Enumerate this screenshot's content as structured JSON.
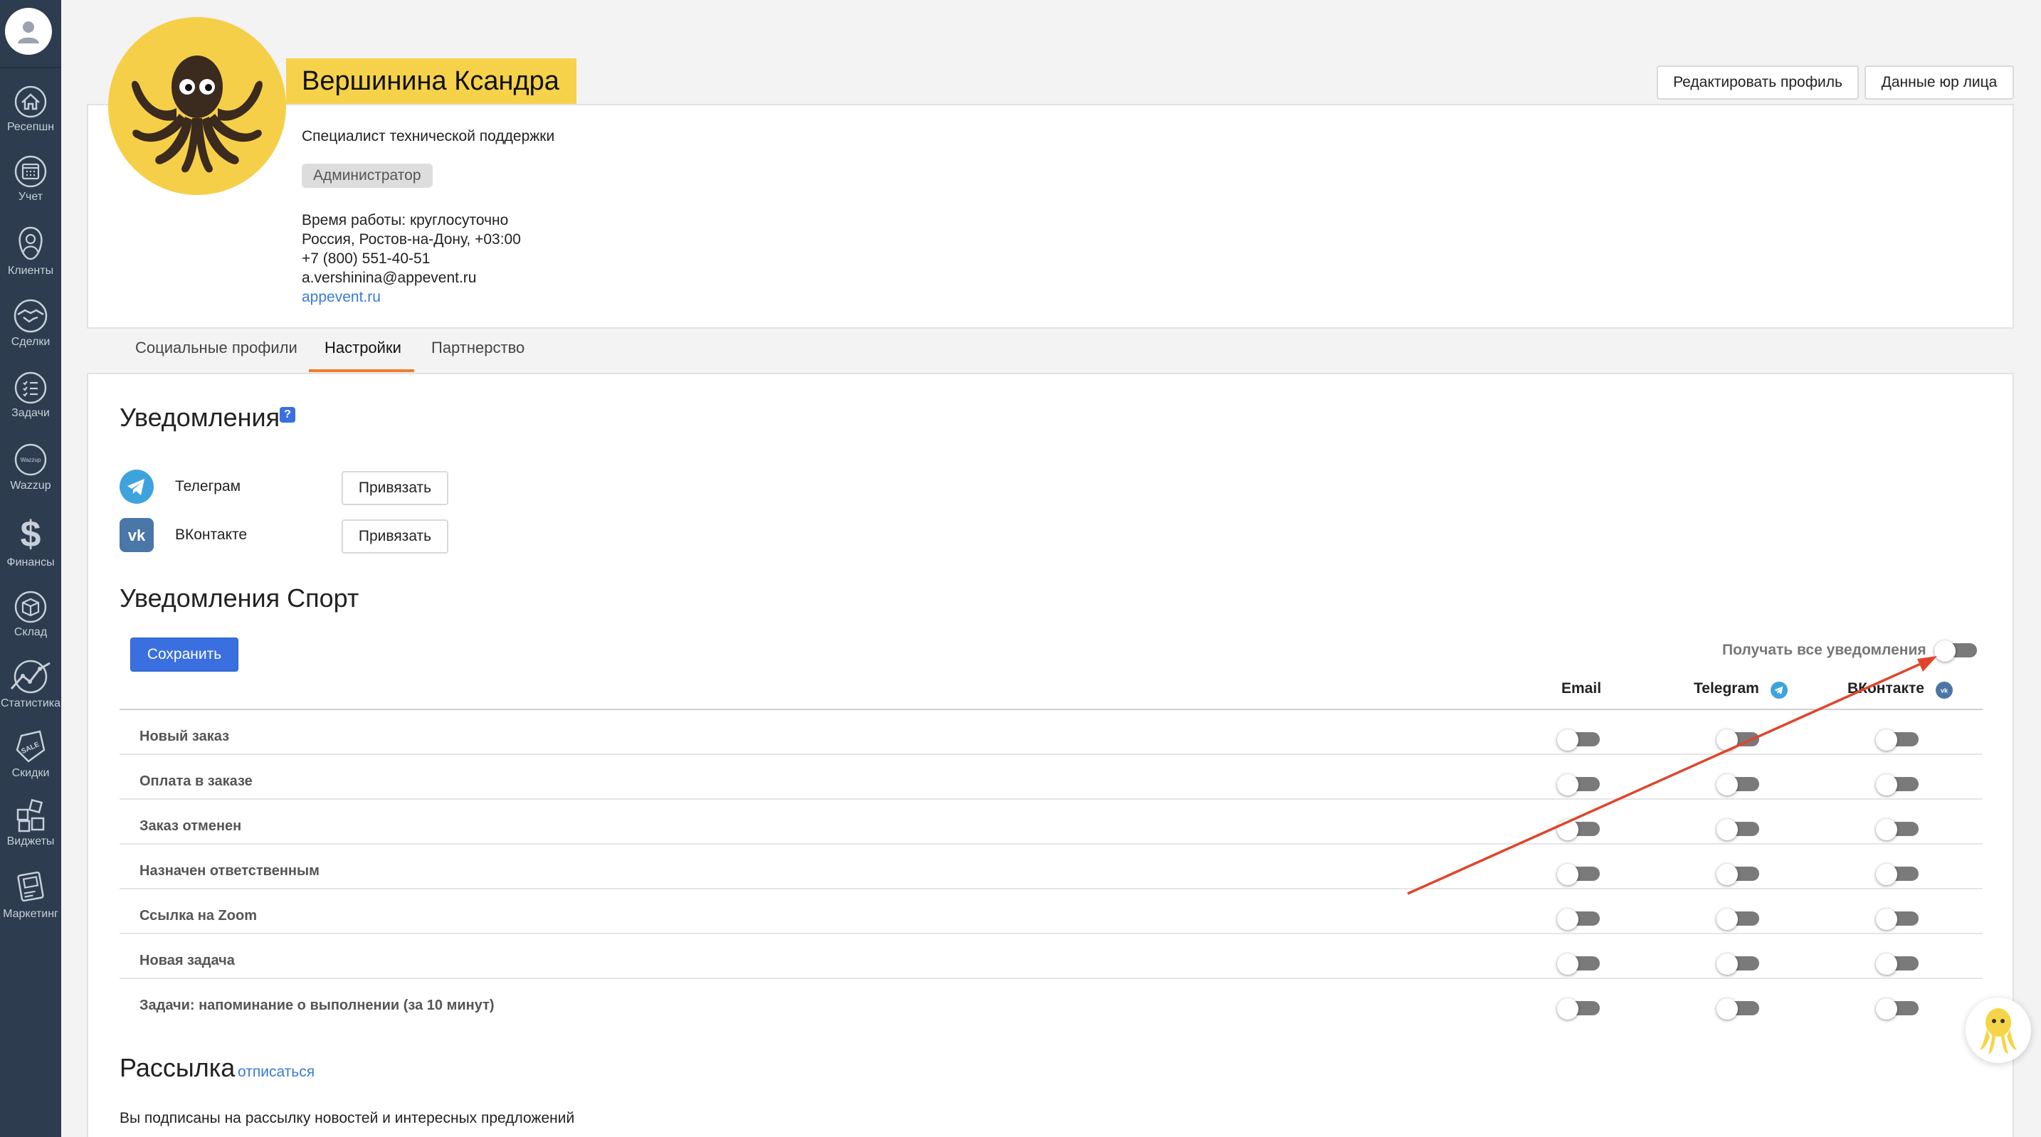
{
  "sidebar": {
    "items": [
      {
        "label": "Ресепшн",
        "icon": "home-icon"
      },
      {
        "label": "Учет",
        "icon": "calendar-icon"
      },
      {
        "label": "Клиенты",
        "icon": "clients-icon"
      },
      {
        "label": "Сделки",
        "icon": "handshake-icon"
      },
      {
        "label": "Задачи",
        "icon": "tasks-icon"
      },
      {
        "label": "Wazzup",
        "icon": "wazzup-icon",
        "badge_text": "Wazzup"
      },
      {
        "label": "Финансы",
        "icon": "dollar-icon"
      },
      {
        "label": "Склад",
        "icon": "box-icon"
      },
      {
        "label": "Статистика",
        "icon": "chart-line-icon"
      },
      {
        "label": "Скидки",
        "icon": "sale-tag-icon",
        "badge_text": "SALE"
      },
      {
        "label": "Виджеты",
        "icon": "widgets-icon"
      },
      {
        "label": "Маркетинг",
        "icon": "marketing-icon"
      }
    ]
  },
  "profile": {
    "name": "Вершинина Ксандра",
    "job_title": "Специалист технической поддержки",
    "role": "Администратор",
    "work_hours": "Время работы: круглосуточно",
    "location": "Россия, Ростов-на-Дону, +03:00",
    "phone": "+7 (800) 551-40-51",
    "email": "a.vershinina@appevent.ru",
    "website": "appevent.ru",
    "edit_button": "Редактировать профиль",
    "legal_button": "Данные юр лица"
  },
  "tabs": [
    {
      "label": "Социальные профили",
      "active": false
    },
    {
      "label": "Настройки",
      "active": true
    },
    {
      "label": "Партнерство",
      "active": false
    }
  ],
  "notifications": {
    "title": "Уведомления",
    "help": "?",
    "channels": [
      {
        "name": "Телеграм",
        "button": "Привязать",
        "icon": "telegram-icon"
      },
      {
        "name": "ВКонтакте",
        "button": "Привязать",
        "icon": "vk-icon"
      }
    ]
  },
  "sport": {
    "title": "Уведомления Спорт",
    "save_button": "Сохранить",
    "receive_all_label": "Получать все уведомления",
    "receive_all": false,
    "columns": [
      "Email",
      "Telegram",
      "ВКонтакте"
    ],
    "rows": [
      {
        "label": "Новый заказ",
        "email": false,
        "telegram": false,
        "vk": false
      },
      {
        "label": "Оплата в заказе",
        "email": false,
        "telegram": false,
        "vk": false
      },
      {
        "label": "Заказ отменен",
        "email": false,
        "telegram": false,
        "vk": false
      },
      {
        "label": "Назначен ответственным",
        "email": false,
        "telegram": false,
        "vk": false
      },
      {
        "label": "Ссылка на Zoom",
        "email": false,
        "telegram": false,
        "vk": false
      },
      {
        "label": "Новая задача",
        "email": false,
        "telegram": false,
        "vk": false
      },
      {
        "label": "Задачи: напоминание о выполнении (за 10 минут)",
        "email": false,
        "telegram": false,
        "vk": false
      }
    ]
  },
  "mailing": {
    "title": "Рассылка",
    "unsubscribe": "отписаться",
    "text": "Вы подписаны на рассылку новостей и интересных предложений"
  },
  "colors": {
    "sidebar_bg": "#2d3c4e",
    "accent_blue": "#3a6fe0",
    "name_banner": "#f5d24a",
    "tab_underline": "#ef7d2b",
    "annotation_arrow": "#e0452c",
    "telegram": "#3ea3dd",
    "vk": "#4a76a8"
  }
}
